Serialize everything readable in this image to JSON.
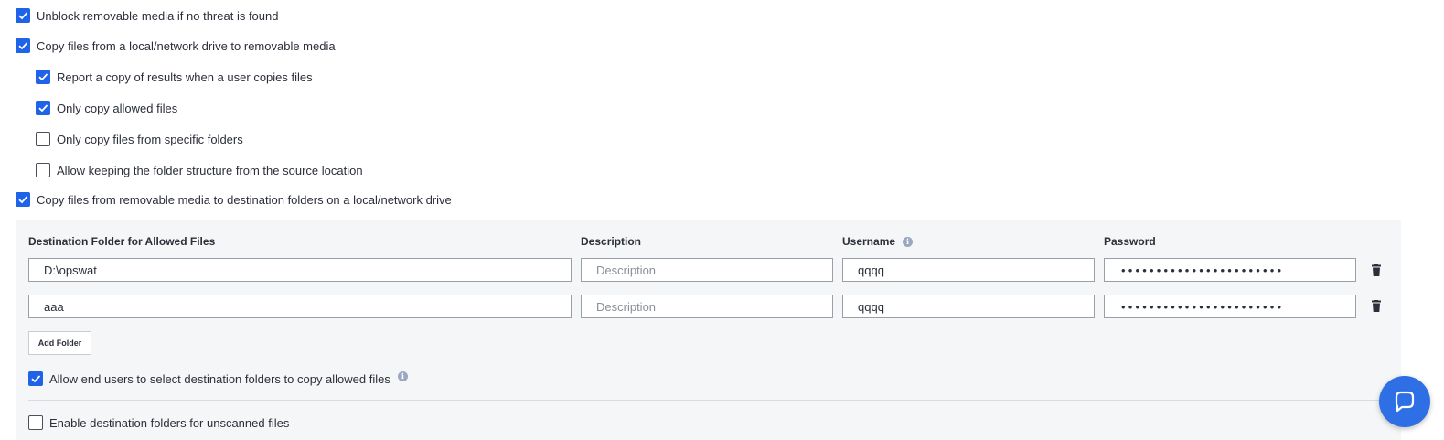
{
  "options": {
    "unblock_removable": {
      "label": "Unblock removable media if no threat is found",
      "checked": true
    },
    "copy_local_to_removable": {
      "label": "Copy files from a local/network drive to removable media",
      "checked": true
    },
    "report_copy": {
      "label": "Report a copy of results when a user copies files",
      "checked": true
    },
    "only_allowed": {
      "label": "Only copy allowed files",
      "checked": true
    },
    "only_specific_folders": {
      "label": "Only copy files from specific folders",
      "checked": false
    },
    "keep_structure": {
      "label": "Allow keeping the folder structure from the source location",
      "checked": false
    },
    "copy_removable_to_dest": {
      "label": "Copy files from removable media to destination folders on a local/network drive",
      "checked": true
    }
  },
  "destinations": {
    "headers": {
      "folder": "Destination Folder for Allowed Files",
      "description": "Description",
      "username": "Username",
      "password": "Password"
    },
    "description_placeholder": "Description",
    "rows": [
      {
        "folder": "D:\\opswat",
        "description": "",
        "username": "qqqq",
        "password": "•••••••••••••••••••••••"
      },
      {
        "folder": "aaa",
        "description": "",
        "username": "qqqq",
        "password": "•••••••••••••••••••••••"
      }
    ],
    "add_folder_label": "Add Folder",
    "allow_end_users": {
      "label": "Allow end users to select destination folders to copy allowed files",
      "checked": true
    },
    "enable_unscanned": {
      "label": "Enable destination folders for unscanned files",
      "checked": false
    }
  },
  "colors": {
    "accent": "#1f63e8",
    "chat": "#2f6fe6",
    "panel": "#f5f6f8"
  },
  "icons": {
    "info": "info-icon",
    "trash": "trash-icon",
    "chat": "chat-icon"
  }
}
